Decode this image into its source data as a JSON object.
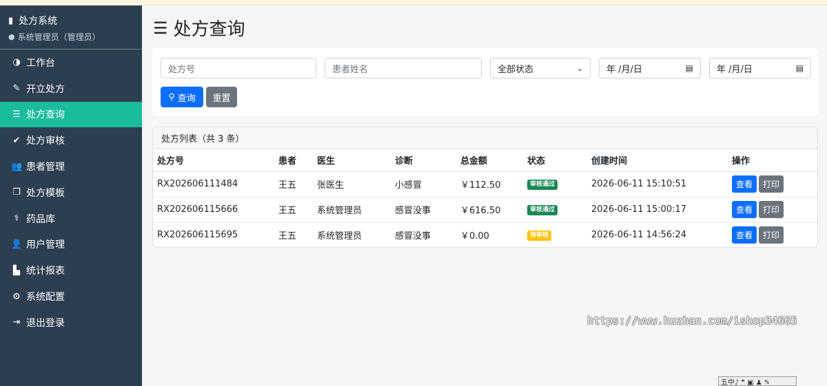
{
  "sidebar": {
    "brand": {
      "icon": "document-icon",
      "title": "处方系统",
      "user": "系统管理员（管理员）"
    },
    "items": [
      {
        "label": "工作台",
        "icon": "◑",
        "active": false
      },
      {
        "label": "开立处方",
        "icon": "✎",
        "active": false
      },
      {
        "label": "处方查询",
        "icon": "☰",
        "active": true
      },
      {
        "label": "处方审核",
        "icon": "✔",
        "active": false
      },
      {
        "label": "患者管理",
        "icon": "👥",
        "active": false
      },
      {
        "label": "处方模板",
        "icon": "❐",
        "active": false
      },
      {
        "label": "药品库",
        "icon": "⚕",
        "active": false
      },
      {
        "label": "用户管理",
        "icon": "👤",
        "active": false
      },
      {
        "label": "统计报表",
        "icon": "▙",
        "active": false
      },
      {
        "label": "系统配置",
        "icon": "⚙",
        "active": false
      },
      {
        "label": "退出登录",
        "icon": "⇥",
        "active": false
      }
    ]
  },
  "page": {
    "title": "处方查询",
    "title_icon": "list-icon"
  },
  "filters": {
    "rx_no_placeholder": "处方号",
    "patient_placeholder": "患者姓名",
    "status_selected": "全部状态",
    "date_from": "年 /月/日",
    "date_to": "年 /月/日",
    "search_label": "查询",
    "reset_label": "重置"
  },
  "list": {
    "header": "处方列表（共 3 条）",
    "columns": [
      "处方号",
      "患者",
      "医生",
      "诊断",
      "总金额",
      "状态",
      "创建时间",
      "操作"
    ],
    "rows": [
      {
        "rx_no": "RX202606111484",
        "patient": "王五",
        "doctor": "张医生",
        "diagnosis": "小感冒",
        "amount": "￥112.50",
        "status": "审核通过",
        "status_color": "#198754",
        "created": "2026-06-11 15:10:51",
        "view": "查看",
        "print": "打印"
      },
      {
        "rx_no": "RX202606115666",
        "patient": "王五",
        "doctor": "系统管理员",
        "diagnosis": "感冒没事",
        "amount": "￥616.50",
        "status": "审核通过",
        "status_color": "#198754",
        "created": "2026-06-11 15:00:17",
        "view": "查看",
        "print": "打印"
      },
      {
        "rx_no": "RX202606115695",
        "patient": "王五",
        "doctor": "系统管理员",
        "diagnosis": "感冒没事",
        "amount": "￥0.00",
        "status": "待审核",
        "status_color": "#ffc107",
        "created": "2026-06-11 14:56:24",
        "view": "查看",
        "print": "打印"
      }
    ]
  },
  "watermark": "https://www.huzhan.com/ishop34665",
  "ime_bar": "五中♪ ❞ ▣ ♟ ✎"
}
